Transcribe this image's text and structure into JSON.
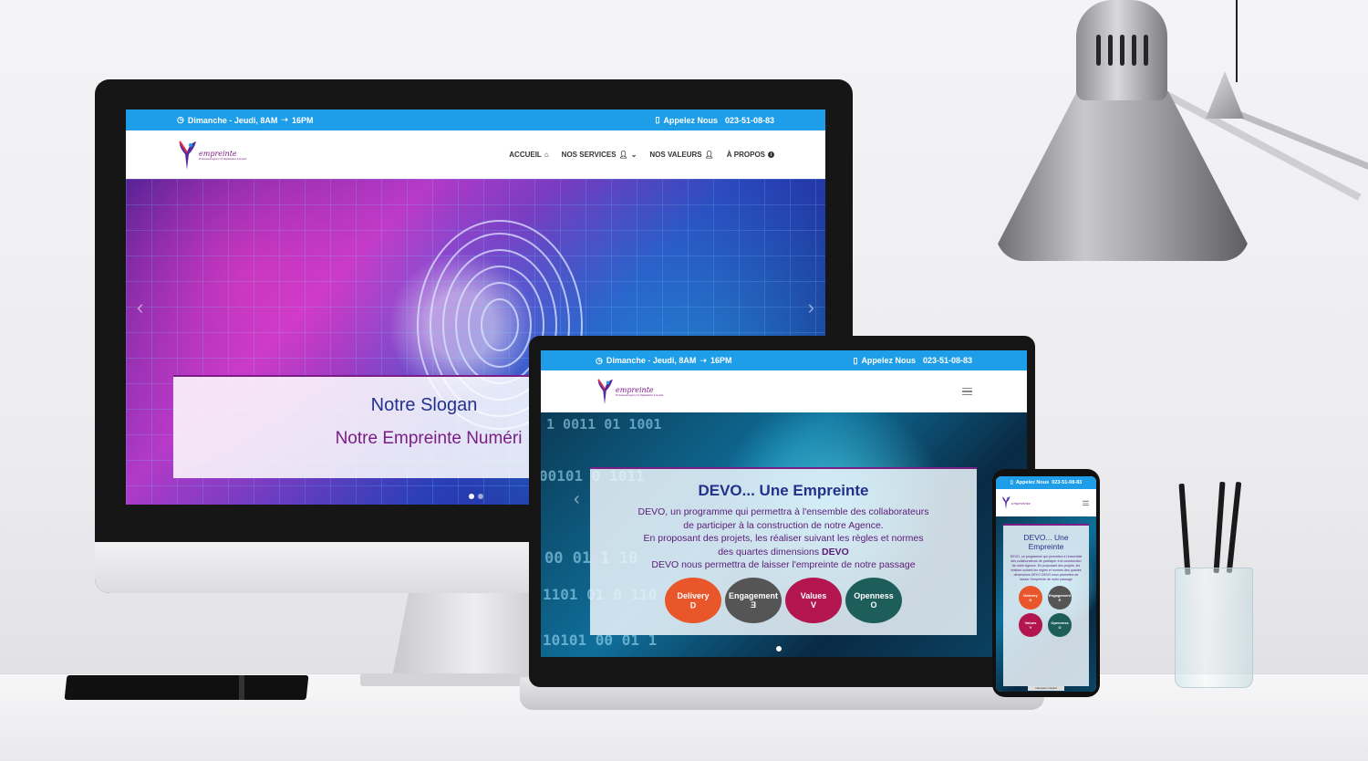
{
  "site": {
    "hours": "Dimanche - Jeudi, 8AM",
    "hours_end": "16PM",
    "phone_label": "Appelez Nous",
    "phone_number": "023-51-08-83",
    "logo_text": "empreinte",
    "logo_tagline": "Professional Agency for Digitalization & Growth",
    "nav": [
      {
        "label": "ACCUEIL",
        "icon": "home-icon"
      },
      {
        "label": "NOS SERVICES",
        "icon": "user-icon"
      },
      {
        "label": "NOS VALEURS",
        "icon": "user-icon"
      },
      {
        "label": "À PROPOS",
        "icon": "info-icon"
      }
    ]
  },
  "desktop_slide": {
    "title": "Notre Slogan",
    "subtitle": "Notre Empreinte Numéri"
  },
  "laptop_slide": {
    "title": "DEVO... Une Empreinte",
    "line1": "DEVO, un programme qui permettra à l'ensemble des collaborateurs",
    "line2": "de participer à la construction de notre Agence.",
    "line3": "En proposant des projets, les réaliser suivant les règles et normes",
    "line4": "des quartes dimensions",
    "line4_bold": "DEVO",
    "line5": "DEVO nous permettra de laisser l'empreinte de notre passage",
    "binary_rows": [
      "1 0011 01 1001",
      "00101 0 1011",
      "00 01 1 10",
      "1101 01 0 110",
      "10101 00 01 1"
    ]
  },
  "values": [
    {
      "name": "Delivery",
      "letter": "D",
      "color": "#e8562a"
    },
    {
      "name": "Engagement",
      "letter": "E",
      "color": "#555555"
    },
    {
      "name": "Values",
      "letter": "V",
      "color": "#b3164f"
    },
    {
      "name": "Openness",
      "letter": "O",
      "color": "#1d5e5a"
    }
  ],
  "phone_slide": {
    "title": "DEVO... Une Empreinte",
    "text": "DEVO, un programme qui permettra à l'ensemble des collaborateurs de participer à la construction de notre Agence. En proposant des projets, les réaliser suivant les règles et normes des quartes dimensions DEVO DEVO nous permettra de laisser l'empreinte de notre passage",
    "footer_button": "Navigation Digital"
  },
  "colors": {
    "topbar": "#1e9ee8",
    "brand_purple": "#7a1d86",
    "brand_navy": "#23318c"
  }
}
